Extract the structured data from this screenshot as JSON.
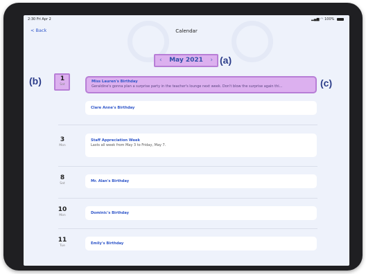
{
  "status_bar": {
    "time": "2:30 Fri Apr 2",
    "system": "100%"
  },
  "nav": {
    "back_label": "< Back",
    "title": "Calendar"
  },
  "month_selector": {
    "prev_icon": "‹",
    "label": "May 2021",
    "next_icon": "›"
  },
  "annotations": {
    "a": "(a)",
    "b": "(b)",
    "c": "(c)"
  },
  "days": [
    {
      "num": "1",
      "dow": "Sat"
    },
    {
      "num": "3",
      "dow": "Mon"
    },
    {
      "num": "8",
      "dow": "Sat"
    },
    {
      "num": "10",
      "dow": "Mon"
    },
    {
      "num": "11",
      "dow": "Tue"
    }
  ],
  "events": [
    {
      "title": "Miss Lauren's Birthday",
      "description": "Geraldine's gonna plan a surprise party in the teacher's lounge next week. Don't blow the surprise again thi..."
    },
    {
      "title": "Clare Anne's Birthday",
      "description": ""
    },
    {
      "title": "Staff Appreciation Week",
      "description": "Lasts all week from May 3 to Friday, May 7."
    },
    {
      "title": "Mr. Alan's Birthday",
      "description": ""
    },
    {
      "title": "Dominic's Birthday",
      "description": ""
    },
    {
      "title": "Emily's Birthday",
      "description": ""
    }
  ],
  "colors": {
    "highlight_fill": "#dcb0ef",
    "highlight_border": "#b77ed6",
    "accent": "#2e55c9",
    "background": "#eef2fb"
  }
}
